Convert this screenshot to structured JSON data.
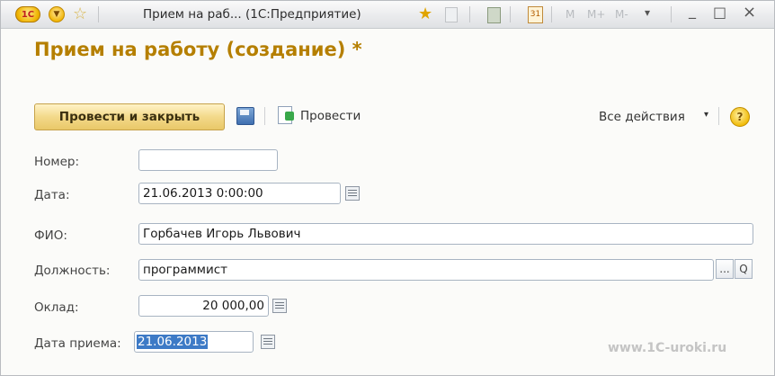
{
  "window": {
    "title": "Прием на раб...  (1С:Предприятие)",
    "logo_text": "1С",
    "title_controls": {
      "m": "M",
      "m_plus": "M+",
      "m_minus": "M-",
      "dropdown": "▾",
      "minimize": "_",
      "maximize": "□",
      "close": "×"
    },
    "calendar_icon_text": "31"
  },
  "form": {
    "title": "Прием на работу (создание) *",
    "toolbar": {
      "post_and_close": "Провести и закрыть",
      "post": "Провести",
      "all_actions": "Все действия",
      "all_actions_caret": "▾",
      "help": "?"
    },
    "fields": {
      "number": {
        "label": "Номер:",
        "value": ""
      },
      "date": {
        "label": "Дата:",
        "value": "21.06.2013  0:00:00"
      },
      "fio": {
        "label": "ФИО:",
        "value": "Горбачев Игорь Львович"
      },
      "position": {
        "label": "Должность:",
        "value": "программист",
        "ellipsis": "...",
        "search": "Q"
      },
      "salary": {
        "label": "Оклад:",
        "value": "20 000,00"
      },
      "hire_date": {
        "label": "Дата приема:",
        "value": "21.06.2013"
      }
    }
  },
  "watermark": "www.1C-uroki.ru",
  "colors": {
    "title_accent": "#b57f00",
    "primary_button": "#f3d98a",
    "selection": "#3d7ac6"
  }
}
